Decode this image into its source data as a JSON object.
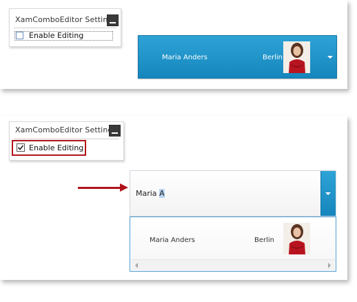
{
  "settings_panel": {
    "title": "XamComboEditor Settings",
    "checkbox_label": "Enable Editing"
  },
  "before": {
    "enable_editing_checked": false,
    "combo": {
      "name": "Maria Anders",
      "city": "Berlin"
    }
  },
  "after": {
    "enable_editing_checked": true,
    "combo_input": {
      "typed_prefix": "Maria ",
      "selected_suffix": "A"
    },
    "dropdown_items": [
      {
        "name": "Maria Anders",
        "city": "Berlin"
      }
    ]
  },
  "colors": {
    "accent_blue": "#1a8fc7",
    "highlight_red": "#b1121a",
    "selection": "#b8d6f2"
  },
  "icons": [
    "minimize-icon",
    "chevron-down-icon",
    "arrow-right-icon",
    "checkmark-icon",
    "scroll-left-icon",
    "scroll-right-icon"
  ]
}
